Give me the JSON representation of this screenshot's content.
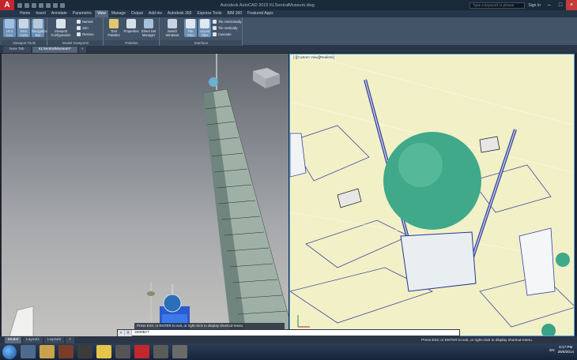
{
  "titlebar": {
    "title": "Autodesk AutoCAD 2015   KLSentralMuseum.dwg",
    "search_placeholder": "Type a keyword or phrase",
    "signin": "Sign In"
  },
  "ribbon_tabs": [
    "Home",
    "Insert",
    "Annotate",
    "Parametric",
    "View",
    "Manage",
    "Output",
    "Add-ins",
    "Autodesk 360",
    "Express Tools",
    "BIM 360",
    "Featured Apps"
  ],
  "active_ribbon_tab": "View",
  "ribbon": {
    "viewport_tools": {
      "title": "Viewport Tools",
      "ucs_icon": "UCS Icon",
      "view_cube": "View Cube",
      "navigation_bar": "Navigation Bar"
    },
    "model_viewports": {
      "title": "Model Viewports",
      "viewport_config": "Viewport Configuration",
      "named": "Named",
      "join": "Join",
      "restore": "Restore"
    },
    "palettes": {
      "title": "Palettes",
      "tool_palettes": "Tool Palettes",
      "properties": "Properties",
      "sheet_set_manager": "Sheet Set Manager"
    },
    "interface": {
      "title": "Interface",
      "switch_windows": "Switch Windows",
      "file_tabs": "File Tabs",
      "layout_tabs": "Layout Tabs",
      "tile_horizontally": "Tile Horizontally",
      "tile_vertically": "Tile Vertically",
      "cascade": "Cascade"
    }
  },
  "file_tabs": [
    "New Tab",
    "KLSentralMuseum*"
  ],
  "active_file_tab": "KLSentralMuseum*",
  "viewports": {
    "right_label": "[-][Custom View][Realistic]"
  },
  "command": {
    "history": "Press ESC or ENTER to exit, or right-click to display shortcut-menu.",
    "current": "3DORBIT"
  },
  "layout_tabs": [
    "Model",
    "Layout1",
    "Layout2"
  ],
  "active_layout_tab": "Model",
  "status_message": "Press ESC or ENTER to exit, or right-click to display shortcut-menu.",
  "taskbar": {
    "language": "EN",
    "time": "6:17 PM",
    "date": "25/6/2014"
  },
  "colors": {
    "autocad_red": "#c4262e",
    "ribbon": "#445468",
    "viewport_active_border": "#4aa3e0",
    "realistic_ground": "#f2f0c6",
    "dome": "#3fa98a"
  }
}
